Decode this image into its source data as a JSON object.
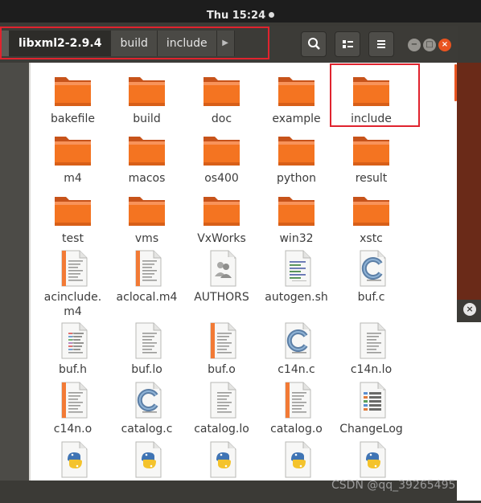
{
  "topbar": {
    "clock": "Thu 15:24"
  },
  "pathbar": {
    "segments": [
      "libxml2-2.9.4",
      "build",
      "include"
    ]
  },
  "files": [
    {
      "name": "bakefile",
      "type": "folder"
    },
    {
      "name": "build",
      "type": "folder"
    },
    {
      "name": "doc",
      "type": "folder"
    },
    {
      "name": "example",
      "type": "folder"
    },
    {
      "name": "include",
      "type": "folder"
    },
    {
      "name": "m4",
      "type": "folder"
    },
    {
      "name": "macos",
      "type": "folder"
    },
    {
      "name": "os400",
      "type": "folder"
    },
    {
      "name": "python",
      "type": "folder"
    },
    {
      "name": "result",
      "type": "folder"
    },
    {
      "name": "test",
      "type": "folder"
    },
    {
      "name": "vms",
      "type": "folder"
    },
    {
      "name": "VxWorks",
      "type": "folder"
    },
    {
      "name": "win32",
      "type": "folder"
    },
    {
      "name": "xstc",
      "type": "folder"
    },
    {
      "name": "acinclude.\nm4",
      "type": "doc-orange"
    },
    {
      "name": "aclocal.m4",
      "type": "doc-orange"
    },
    {
      "name": "AUTHORS",
      "type": "authors"
    },
    {
      "name": "autogen.sh",
      "type": "script"
    },
    {
      "name": "buf.c",
      "type": "c-source"
    },
    {
      "name": "buf.h",
      "type": "header"
    },
    {
      "name": "buf.lo",
      "type": "doc-plain"
    },
    {
      "name": "buf.o",
      "type": "doc-orange"
    },
    {
      "name": "c14n.c",
      "type": "c-source"
    },
    {
      "name": "c14n.lo",
      "type": "doc-plain"
    },
    {
      "name": "c14n.o",
      "type": "doc-orange"
    },
    {
      "name": "catalog.c",
      "type": "c-source"
    },
    {
      "name": "catalog.lo",
      "type": "doc-plain"
    },
    {
      "name": "catalog.o",
      "type": "doc-orange"
    },
    {
      "name": "ChangeLog",
      "type": "changelog"
    },
    {
      "name": "",
      "type": "python"
    },
    {
      "name": "",
      "type": "python"
    },
    {
      "name": "",
      "type": "python"
    },
    {
      "name": "",
      "type": "python"
    },
    {
      "name": "",
      "type": "python"
    }
  ],
  "watermark": "CSDN @qq_39265495",
  "colors": {
    "accent": "#e95420",
    "folder": "#f47421",
    "highlight": "#e0232e"
  }
}
